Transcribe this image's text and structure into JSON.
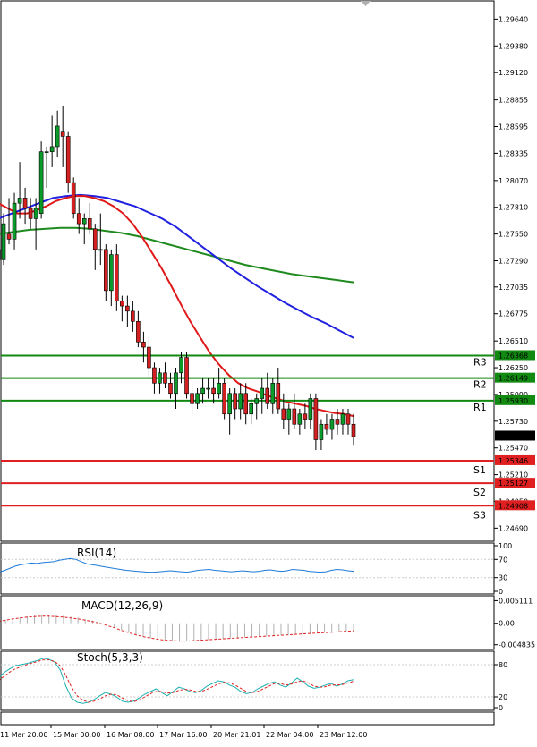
{
  "chart_data": [
    {
      "type": "candlestick",
      "name": "price",
      "y_ticks": [
        "1.29640",
        "1.29380",
        "1.29120",
        "1.28855",
        "1.28595",
        "1.28335",
        "1.28070",
        "1.27810",
        "1.27550",
        "1.27290",
        "1.27035",
        "1.26775",
        "1.26510",
        "1.26250",
        "1.25990",
        "1.25730",
        "1.25470",
        "1.25210",
        "1.24950",
        "1.24690"
      ],
      "ylim": [
        1.2458,
        1.298
      ],
      "x_ticks": [
        "11 Mar 20:00",
        "15 Mar 00:00",
        "16 Mar 08:00",
        "17 Mar 16:00",
        "20 Mar 21:01",
        "22 Mar 04:00",
        "23 Mar 12:00"
      ],
      "candles": [
        [
          1.274,
          1.278,
          1.272,
          1.273
        ],
        [
          1.273,
          1.2775,
          1.2725,
          1.2765
        ],
        [
          1.2755,
          1.279,
          1.2745,
          1.275
        ],
        [
          1.275,
          1.2795,
          1.274,
          1.2785
        ],
        [
          1.2785,
          1.2825,
          1.277,
          1.279
        ],
        [
          1.279,
          1.28,
          1.2765,
          1.278
        ],
        [
          1.278,
          1.279,
          1.276,
          1.277
        ],
        [
          1.277,
          1.279,
          1.274,
          1.278
        ],
        [
          1.2775,
          1.2845,
          1.277,
          1.2835
        ],
        [
          1.2835,
          1.284,
          1.28,
          1.2835
        ],
        [
          1.2835,
          1.287,
          1.282,
          1.284
        ],
        [
          1.284,
          1.2875,
          1.283,
          1.286
        ],
        [
          1.2855,
          1.288,
          1.282,
          1.285
        ],
        [
          1.285,
          1.2855,
          1.2795,
          1.2805
        ],
        [
          1.2805,
          1.281,
          1.277,
          1.2775
        ],
        [
          1.2775,
          1.279,
          1.2755,
          1.2765
        ],
        [
          1.2765,
          1.2775,
          1.2745,
          1.277
        ],
        [
          1.277,
          1.2785,
          1.2755,
          1.276
        ],
        [
          1.276,
          1.2765,
          1.272,
          1.274
        ],
        [
          1.274,
          1.2775,
          1.2725,
          1.274
        ],
        [
          1.274,
          1.2745,
          1.269,
          1.27
        ],
        [
          1.27,
          1.274,
          1.2685,
          1.2735
        ],
        [
          1.2735,
          1.2745,
          1.268,
          1.269
        ],
        [
          1.269,
          1.2695,
          1.267,
          1.2685
        ],
        [
          1.2685,
          1.2695,
          1.2665,
          1.268
        ],
        [
          1.268,
          1.269,
          1.266,
          1.267
        ],
        [
          1.267,
          1.268,
          1.2645,
          1.265
        ],
        [
          1.265,
          1.266,
          1.263,
          1.2645
        ],
        [
          1.2645,
          1.2655,
          1.2615,
          1.2625
        ],
        [
          1.2625,
          1.263,
          1.26,
          1.261
        ],
        [
          1.261,
          1.2625,
          1.26,
          1.262
        ],
        [
          1.262,
          1.263,
          1.2605,
          1.261
        ],
        [
          1.261,
          1.262,
          1.2595,
          1.26
        ],
        [
          1.26,
          1.2625,
          1.2585,
          1.262
        ],
        [
          1.262,
          1.264,
          1.261,
          1.2635
        ],
        [
          1.2635,
          1.264,
          1.2595,
          1.26
        ],
        [
          1.26,
          1.261,
          1.258,
          1.259
        ],
        [
          1.259,
          1.2605,
          1.2585,
          1.26
        ],
        [
          1.26,
          1.2615,
          1.259,
          1.2605
        ],
        [
          1.2605,
          1.2615,
          1.2595,
          1.2605
        ],
        [
          1.2605,
          1.2615,
          1.259,
          1.26
        ],
        [
          1.26,
          1.2625,
          1.2595,
          1.261
        ],
        [
          1.261,
          1.2615,
          1.2575,
          1.258
        ],
        [
          1.258,
          1.2605,
          1.256,
          1.26
        ],
        [
          1.26,
          1.2605,
          1.2575,
          1.2585
        ],
        [
          1.2585,
          1.261,
          1.2575,
          1.26
        ],
        [
          1.26,
          1.261,
          1.257,
          1.258
        ],
        [
          1.258,
          1.2595,
          1.257,
          1.259
        ],
        [
          1.259,
          1.26,
          1.2575,
          1.2595
        ],
        [
          1.2595,
          1.2615,
          1.258,
          1.2605
        ],
        [
          1.2605,
          1.262,
          1.2585,
          1.259
        ],
        [
          1.259,
          1.2615,
          1.258,
          1.261
        ],
        [
          1.261,
          1.2625,
          1.258,
          1.2585
        ],
        [
          1.2585,
          1.26,
          1.2565,
          1.2575
        ],
        [
          1.2575,
          1.259,
          1.256,
          1.2585
        ],
        [
          1.2585,
          1.26,
          1.2565,
          1.257
        ],
        [
          1.257,
          1.2585,
          1.256,
          1.258
        ],
        [
          1.258,
          1.259,
          1.2565,
          1.2575
        ],
        [
          1.2575,
          1.26,
          1.2565,
          1.2595
        ],
        [
          1.2595,
          1.26,
          1.2545,
          1.2555
        ],
        [
          1.2555,
          1.2575,
          1.2545,
          1.257
        ],
        [
          1.257,
          1.258,
          1.256,
          1.2565
        ],
        [
          1.2565,
          1.258,
          1.2555,
          1.2575
        ],
        [
          1.2575,
          1.2585,
          1.256,
          1.257
        ],
        [
          1.257,
          1.2585,
          1.256,
          1.258
        ],
        [
          1.258,
          1.2585,
          1.256,
          1.257
        ],
        [
          1.257,
          1.258,
          1.255,
          1.2558
        ]
      ],
      "ma_fast_red": [
        1.2785,
        1.278,
        1.2775,
        1.2775,
        1.2778,
        1.2782,
        1.2787,
        1.279,
        1.2792,
        1.2792,
        1.279,
        1.2787,
        1.2782,
        1.2775,
        1.2765,
        1.2752,
        1.2737,
        1.2722,
        1.2705,
        1.2687,
        1.267,
        1.2655,
        1.264,
        1.2628,
        1.2618,
        1.261,
        1.2605,
        1.2602,
        1.2598,
        1.2595,
        1.2592,
        1.259,
        1.2588,
        1.2585,
        1.2583,
        1.2581,
        1.258,
        1.2578
      ],
      "ma_blue": [
        1.277,
        1.2775,
        1.278,
        1.2785,
        1.279,
        1.2792,
        1.2793,
        1.2792,
        1.279,
        1.2786,
        1.2782,
        1.2776,
        1.277,
        1.2762,
        1.2752,
        1.2742,
        1.2732,
        1.2722,
        1.2713,
        1.2704,
        1.2696,
        1.2688,
        1.2681,
        1.2674,
        1.2668,
        1.2661,
        1.2654
      ],
      "ma_green": [
        1.2755,
        1.2757,
        1.2759,
        1.276,
        1.2761,
        1.2761,
        1.276,
        1.2758,
        1.2756,
        1.2753,
        1.2749,
        1.2745,
        1.2741,
        1.2737,
        1.2733,
        1.2729,
        1.2725,
        1.2722,
        1.2719,
        1.2716,
        1.2714,
        1.2712,
        1.271,
        1.2708
      ],
      "levels": [
        {
          "label": "R3",
          "value": "1.26368",
          "kind": "resistance"
        },
        {
          "label": "R2",
          "value": "1.26149",
          "kind": "resistance"
        },
        {
          "label": "R1",
          "value": "1.25930",
          "kind": "resistance"
        },
        {
          "label": "S1",
          "value": "1.25346",
          "kind": "support"
        },
        {
          "label": "S2",
          "value": "1.25127",
          "kind": "support"
        },
        {
          "label": "S3",
          "value": "1.24908",
          "kind": "support"
        }
      ],
      "current_price": "1.25585"
    },
    {
      "type": "line",
      "name": "rsi",
      "title": "RSI(14)",
      "y_ticks": [
        "100",
        "70",
        "30",
        "0"
      ],
      "ylim": [
        0,
        100
      ],
      "values": [
        42,
        45,
        50,
        55,
        58,
        60,
        62,
        61,
        63,
        64,
        65,
        68,
        70,
        72,
        70,
        65,
        60,
        58,
        56,
        54,
        52,
        50,
        48,
        46,
        45,
        44,
        43,
        42,
        42,
        43,
        44,
        45,
        44,
        43,
        42,
        44,
        46,
        47,
        48,
        46,
        45,
        44,
        43,
        44,
        45,
        44,
        43,
        44,
        46,
        47,
        45,
        44,
        45,
        48,
        47,
        46,
        44,
        43,
        42,
        43,
        46,
        48,
        47,
        45,
        44
      ]
    },
    {
      "type": "line",
      "name": "macd",
      "title": "MACD(12,26,9)",
      "y_ticks": [
        "0.005111",
        "0.00",
        "-0.004835"
      ],
      "ylim": [
        -0.0055,
        0.0058
      ],
      "histogram": [
        0.0005,
        0.0008,
        0.0011,
        0.0014,
        0.0016,
        0.0018,
        0.0019,
        0.0019,
        0.0018,
        0.0017,
        0.0015,
        0.0013,
        0.001,
        0.0006,
        0.0002,
        -0.0003,
        -0.0009,
        -0.0015,
        -0.0021,
        -0.0026,
        -0.003,
        -0.0034,
        -0.0037,
        -0.0039,
        -0.004,
        -0.0041,
        -0.004,
        -0.0039,
        -0.0038,
        -0.0037,
        -0.0036,
        -0.0035,
        -0.0034,
        -0.0033,
        -0.0032,
        -0.0031,
        -0.003,
        -0.0029,
        -0.0028,
        -0.0027,
        -0.0026,
        -0.0025,
        -0.0024,
        -0.0023,
        -0.0022,
        -0.0021,
        -0.002,
        -0.0019,
        -0.0018,
        -0.0017
      ],
      "signal": [
        0.0004,
        0.0007,
        0.001,
        0.0012,
        0.0014,
        0.0015,
        0.0016,
        0.0016,
        0.0015,
        0.0014,
        0.0012,
        0.001,
        0.0007,
        0.0004,
        0.0,
        -0.0005,
        -0.001,
        -0.0016,
        -0.0021,
        -0.0026,
        -0.003,
        -0.0033,
        -0.0036,
        -0.0038,
        -0.0039,
        -0.004,
        -0.004,
        -0.0039,
        -0.0038,
        -0.0037,
        -0.0036,
        -0.0035,
        -0.0034,
        -0.0033,
        -0.0032,
        -0.0031,
        -0.003,
        -0.0029,
        -0.0028,
        -0.0027,
        -0.0026,
        -0.0025,
        -0.0024,
        -0.0023,
        -0.0022,
        -0.0021,
        -0.002,
        -0.0019,
        -0.0018,
        -0.0017
      ]
    },
    {
      "type": "line",
      "name": "stoch",
      "title": "Stoch(5,3,3)",
      "y_ticks": [
        "80",
        "20",
        "0"
      ],
      "ylim": [
        0,
        100
      ],
      "k": [
        55,
        65,
        72,
        78,
        80,
        82,
        85,
        88,
        92,
        90,
        85,
        70,
        40,
        18,
        10,
        8,
        10,
        15,
        22,
        28,
        25,
        20,
        12,
        10,
        12,
        18,
        25,
        30,
        35,
        28,
        22,
        30,
        38,
        35,
        30,
        28,
        32,
        40,
        45,
        50,
        48,
        42,
        38,
        30,
        26,
        28,
        35,
        40,
        45,
        48,
        42,
        38,
        46,
        55,
        48,
        40,
        36,
        38,
        42,
        45,
        40,
        44,
        50,
        52
      ],
      "d": [
        50,
        58,
        66,
        72,
        76,
        80,
        83,
        86,
        89,
        89,
        86,
        78,
        60,
        38,
        22,
        14,
        10,
        12,
        16,
        22,
        25,
        24,
        18,
        13,
        11,
        14,
        20,
        26,
        30,
        30,
        27,
        28,
        32,
        34,
        33,
        30,
        30,
        34,
        39,
        44,
        47,
        46,
        42,
        36,
        30,
        28,
        30,
        35,
        40,
        45,
        45,
        42,
        44,
        48,
        50,
        46,
        40,
        38,
        39,
        42,
        42,
        43,
        46,
        49
      ]
    }
  ]
}
